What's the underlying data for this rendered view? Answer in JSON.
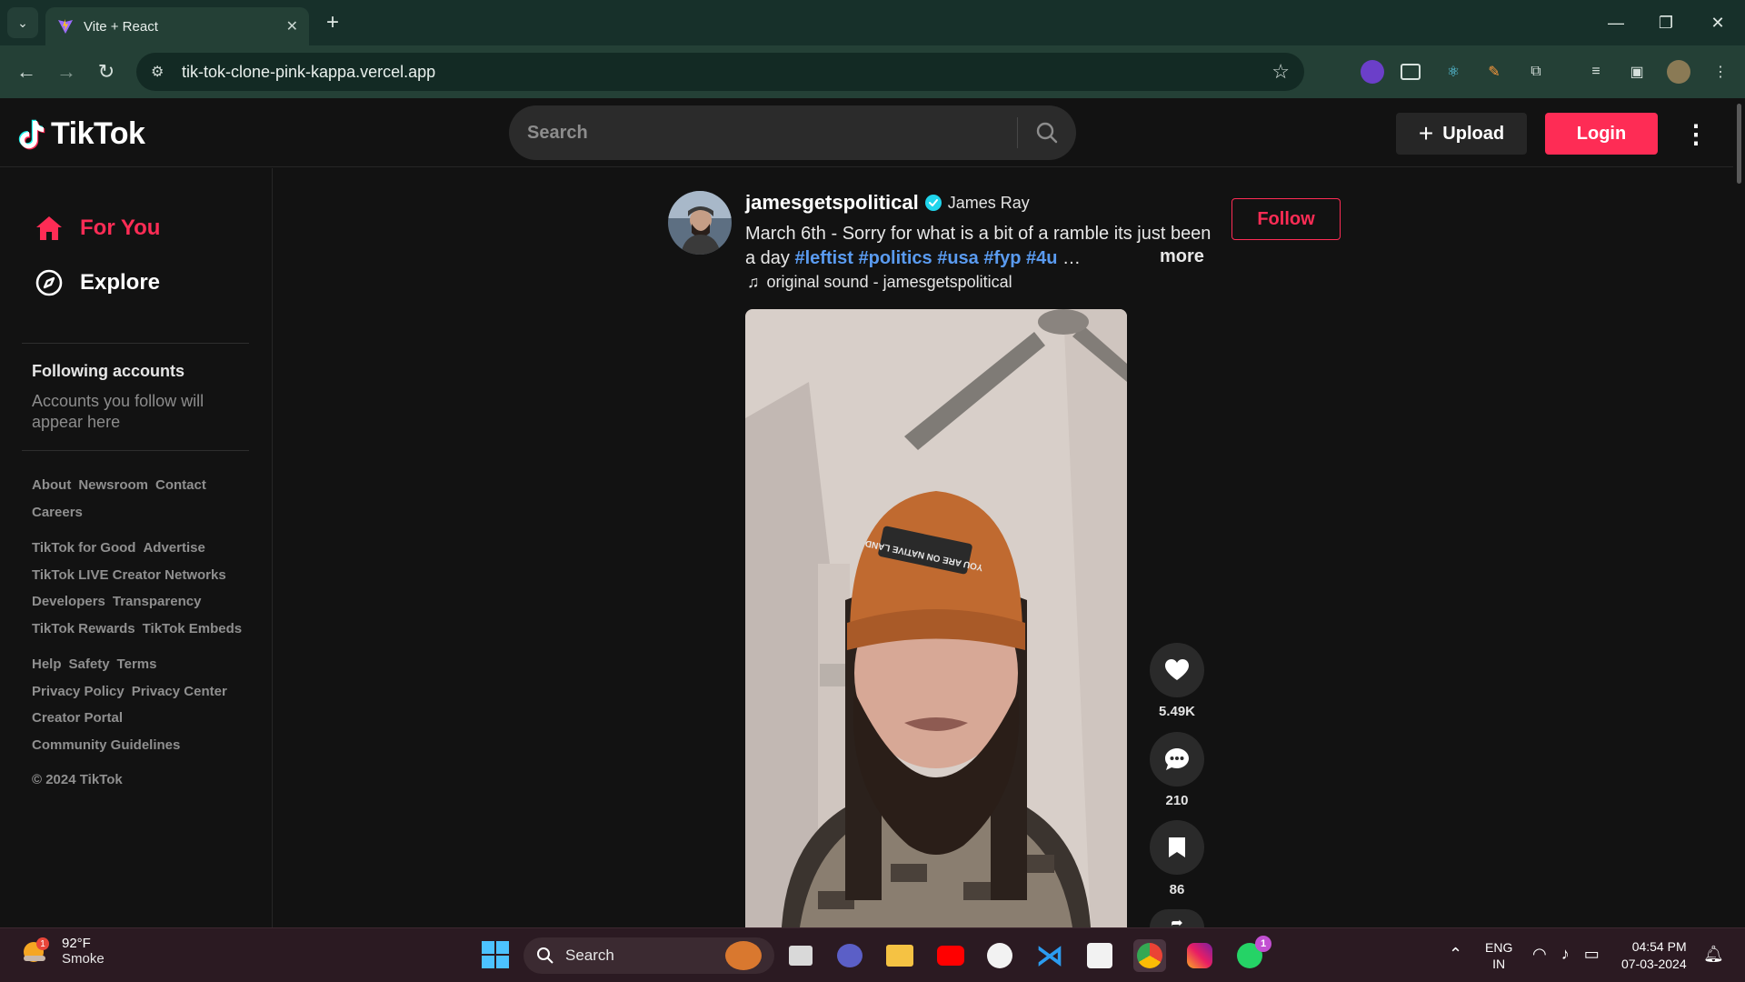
{
  "browser": {
    "tab_title": "Vite + React",
    "tab_close": "✕",
    "new_tab": "+",
    "url": "tik-tok-clone-pink-kappa.vercel.app",
    "window_controls": [
      "—",
      "❐",
      "✕"
    ]
  },
  "header": {
    "logo_text": "TikTok",
    "search_placeholder": "Search",
    "upload_label": "Upload",
    "upload_icon": "+",
    "login_label": "Login",
    "more_icon": "⋮"
  },
  "sidebar": {
    "nav": [
      {
        "label": "For You",
        "icon": "home-icon",
        "active": true
      },
      {
        "label": "Explore",
        "icon": "compass-icon",
        "active": false
      }
    ],
    "following_title": "Following accounts",
    "following_desc": "Accounts you follow will appear here",
    "footer_rows": [
      [
        "About",
        "Newsroom",
        "Contact"
      ],
      [
        "Careers"
      ],
      [
        "TikTok for Good",
        "Advertise"
      ],
      [
        "TikTok LIVE Creator Networks"
      ],
      [
        "Developers",
        "Transparency"
      ],
      [
        "TikTok Rewards",
        "TikTok Embeds"
      ],
      [
        "Help",
        "Safety",
        "Terms"
      ],
      [
        "Privacy Policy",
        "Privacy Center"
      ],
      [
        "Creator Portal"
      ],
      [
        "Community Guidelines"
      ]
    ],
    "copyright": "© 2024 TikTok"
  },
  "post": {
    "username": "jamesgetspolitical",
    "display_name": "James Ray",
    "caption": "March 6th - Sorry for what is a bit of a ramble its just been a day ",
    "hashtags": "#leftist #politics #usa #fyp #4u",
    "ellipsis": " …",
    "more_label": "more",
    "sound": "original sound - jamesgetspolitical",
    "follow_label": "Follow",
    "hat_text": "YOU ARE ON NATIVE LAND",
    "likes": "5.49K",
    "comments": "210",
    "saves": "86"
  },
  "taskbar": {
    "temperature": "92°F",
    "weather": "Smoke",
    "weather_badge": "1",
    "search_label": "Search",
    "whatsapp_badge": "1",
    "lang_top": "ENG",
    "lang_bottom": "IN",
    "time": "04:54 PM",
    "date": "07-03-2024"
  },
  "colors": {
    "accent": "#fe2c55",
    "hashtag": "#5a9bf0",
    "background": "#121212"
  }
}
